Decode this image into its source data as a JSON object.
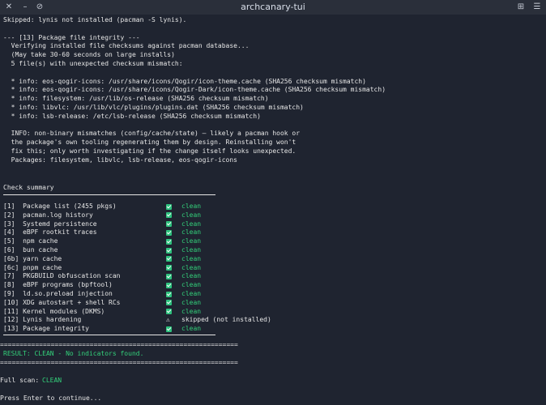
{
  "window": {
    "title": "archcanary-tui"
  },
  "output_top": [
    "Skipped: lynis not installed (pacman -S lynis).",
    "",
    "--- [13] Package file integrity ---",
    "  Verifying installed file checksums against pacman database...",
    "  (May take 30-60 seconds on large installs)",
    "  5 file(s) with unexpected checksum mismatch:",
    "",
    "  * info: eos-qogir-icons: /usr/share/icons/Qogir/icon-theme.cache (SHA256 checksum mismatch)",
    "  * info: eos-qogir-icons: /usr/share/icons/Qogir-Dark/icon-theme.cache (SHA256 checksum mismatch)",
    "  * info: filesystem: /usr/lib/os-release (SHA256 checksum mismatch)",
    "  * info: libvlc: /usr/lib/vlc/plugins/plugins.dat (SHA256 checksum mismatch)",
    "  * info: lsb-release: /etc/lsb-release (SHA256 checksum mismatch)",
    "",
    "  INFO: non-binary mismatches (config/cache/state) — likely a pacman hook or",
    "  the package's own tooling regenerating them by design. Reinstalling won't",
    "  fix this; only worth investigating if the change itself looks unexpected.",
    "  Packages: filesystem, libvlc, lsb-release, eos-qogir-icons"
  ],
  "summary": {
    "heading": "Check summary",
    "rows": [
      {
        "label": "[1]  Package list (2455 pkgs)",
        "mark": "check",
        "status": "clean"
      },
      {
        "label": "[2]  pacman.log history",
        "mark": "check",
        "status": "clean"
      },
      {
        "label": "[3]  Systemd persistence",
        "mark": "check",
        "status": "clean"
      },
      {
        "label": "[4]  eBPF rootkit traces",
        "mark": "check",
        "status": "clean"
      },
      {
        "label": "[5]  npm cache",
        "mark": "check",
        "status": "clean"
      },
      {
        "label": "[6]  bun cache",
        "mark": "check",
        "status": "clean"
      },
      {
        "label": "[6b] yarn cache",
        "mark": "check",
        "status": "clean"
      },
      {
        "label": "[6c] pnpm cache",
        "mark": "check",
        "status": "clean"
      },
      {
        "label": "[7]  PKGBUILD obfuscation scan",
        "mark": "check",
        "status": "clean"
      },
      {
        "label": "[8]  eBPF programs (bpftool)",
        "mark": "check",
        "status": "clean"
      },
      {
        "label": "[9]  ld.so.preload injection",
        "mark": "check",
        "status": "clean"
      },
      {
        "label": "[10] XDG autostart + shell RCs",
        "mark": "check",
        "status": "clean"
      },
      {
        "label": "[11] Kernel modules (DKMS)",
        "mark": "check",
        "status": "clean"
      },
      {
        "label": "[12] Lynis hardening",
        "mark": "warn",
        "warn_symbol": "⚠",
        "status": "skipped (not installed)"
      },
      {
        "label": "[13] Package integrity",
        "mark": "check",
        "status": "clean"
      }
    ]
  },
  "divider": "=============================================================",
  "result": "RESULT: CLEAN - No indicators found.",
  "full_scan": {
    "label": "Full scan:",
    "value": "CLEAN"
  },
  "prompt": "Press Enter to continue...",
  "colors": {
    "background": "#1f2430",
    "text": "#e6e6e6",
    "clean": "#33d17a",
    "check": "#2ec27e"
  }
}
